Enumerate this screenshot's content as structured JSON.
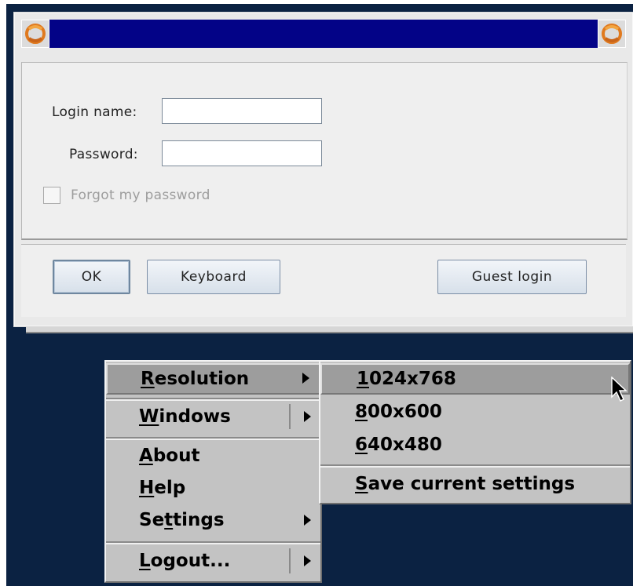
{
  "login_window": {
    "login_name_label": "Login name:",
    "login_name_value": "",
    "password_label": "Password:",
    "password_value": "",
    "forgot_label": "Forgot my password",
    "forgot_checked": false,
    "ok_label": "OK",
    "keyboard_label": "Keyboard",
    "guest_label": "Guest login",
    "title_color": "#030387"
  },
  "main_menu": {
    "items": [
      {
        "label_pre": "",
        "mnemonic": "R",
        "label_post": "esolution",
        "submenu": true,
        "active": true
      },
      {
        "label_pre": "",
        "mnemonic": "W",
        "label_post": "indows",
        "submenu": true
      },
      {
        "label_pre": "",
        "mnemonic": "A",
        "label_post": "bout",
        "submenu": false
      },
      {
        "label_pre": "",
        "mnemonic": "H",
        "label_post": "elp",
        "submenu": false
      },
      {
        "label_pre": "Se",
        "mnemonic": "t",
        "label_post": "tings",
        "submenu": true
      },
      {
        "label_pre": "",
        "mnemonic": "L",
        "label_post": "ogout...",
        "submenu": true
      }
    ]
  },
  "resolution_menu": {
    "items": [
      {
        "mnemonic": "1",
        "label_post": "024x768",
        "active": true
      },
      {
        "mnemonic": "8",
        "label_post": "00x600"
      },
      {
        "mnemonic": "6",
        "label_post": "40x480"
      },
      {
        "mnemonic": "S",
        "label_post": "ave current settings"
      }
    ]
  },
  "colors": {
    "desktop": "#0b2242",
    "menu_bg": "#c3c3c3",
    "menu_active": "#9d9d9d"
  }
}
